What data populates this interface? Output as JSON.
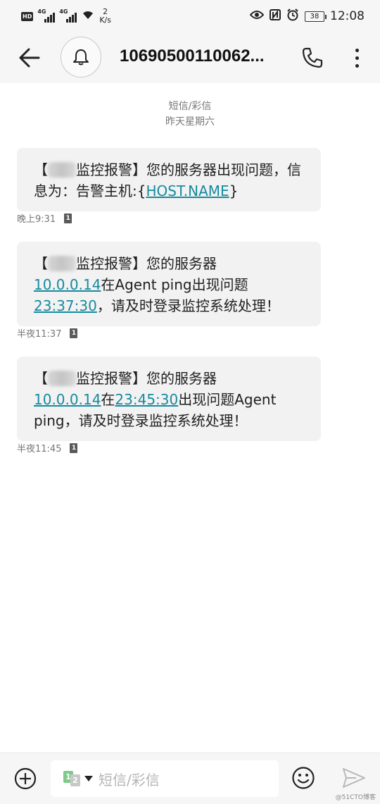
{
  "status_bar": {
    "hd": "HD",
    "net1": "4G",
    "net2": "4G",
    "speed_value": "2",
    "speed_unit": "K/s",
    "battery": "38",
    "time": "12:08"
  },
  "header": {
    "contact": "10690500110062..."
  },
  "conversation": {
    "type_label": "短信/彩信",
    "date_label": "昨天星期六"
  },
  "messages": [
    {
      "pre": "【",
      "after_blur": "监控报警】您的服务器出现问题，信息为：告警主机:{",
      "link1": "HOST.NAME",
      "tail": "}",
      "time": "晚上9:31",
      "sim": "1"
    },
    {
      "pre": "【",
      "after_blur": "监控报警】您的服务器",
      "link1": "10.0.0.14",
      "mid": "在Agent ping出现问题",
      "link2": "23:37:30",
      "tail": "，请及时登录监控系统处理！",
      "time": "半夜11:37",
      "sim": "1"
    },
    {
      "pre": "【",
      "after_blur": "监控报警】您的服务器",
      "link1": "10.0.0.14",
      "mid": "在",
      "link2": "23:45:30",
      "tail": "出现问题Agent ping，请及时登录监控系统处理！",
      "time": "半夜11:45",
      "sim": "1"
    }
  ],
  "composer": {
    "sim_a": "1",
    "sim_b": "2",
    "placeholder": "短信/彩信"
  },
  "watermark": "@51CTO博客",
  "colors": {
    "link": "#178a9e",
    "bubble": "#f2f2f2",
    "bar": "#f6f6f6"
  },
  "icons": [
    "back-arrow-icon",
    "bell-icon",
    "phone-icon",
    "more-vertical-icon",
    "add-circle-icon",
    "emoji-icon",
    "send-icon",
    "sim-card-icon",
    "eye-icon",
    "nfc-icon",
    "alarm-icon",
    "wifi-icon",
    "signal-icon",
    "battery-icon"
  ]
}
